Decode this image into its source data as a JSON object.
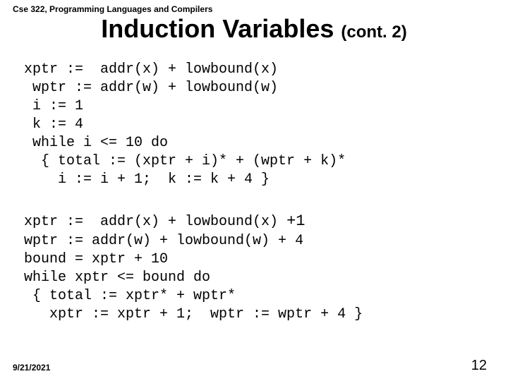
{
  "course": "Cse 322, Programming Languages and Compilers",
  "title_main": "Induction Variables",
  "title_sub": "(cont. 2)",
  "code1": {
    "l1": "xptr :=  addr(x) + lowbound(x)",
    "l2": " wptr := addr(w) + lowbound(w)",
    "l3": " i := 1",
    "l4": " k := 4",
    "l5": " while i <= 10 do",
    "l6": "  { total := (xptr + i)* + (wptr + k)*",
    "l7": "    i := i + 1;  k := k + 4 }"
  },
  "code2": {
    "l1a": "xptr :=  addr(x) + lowbound(x) ",
    "l1b": "+1",
    "l2": "wptr := addr(w) + lowbound(w) + 4",
    "l3": "bound = xptr + 10",
    "l4": "while xptr <= bound do",
    "l5": " { total := xptr* + wptr*",
    "l6": "   xptr := xptr + 1;  wptr := wptr + 4 }"
  },
  "footer": {
    "date": "9/21/2021",
    "page": "12"
  }
}
